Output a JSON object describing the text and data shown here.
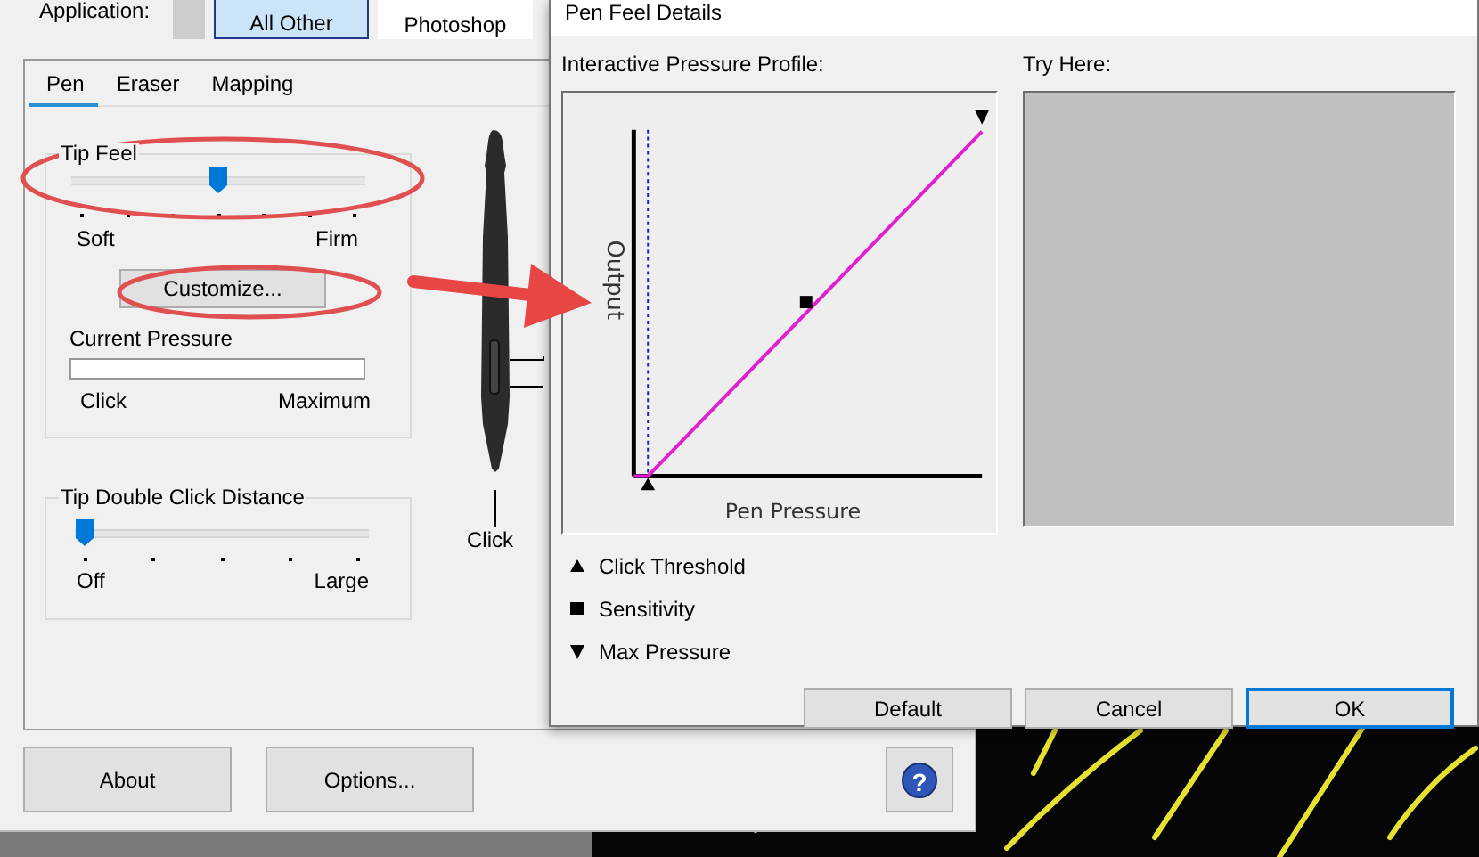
{
  "main_window": {
    "application_label": "Application:",
    "application_tiles": [
      {
        "label": "All Other",
        "selected": true
      },
      {
        "label": "Photoshop",
        "selected": false
      }
    ],
    "tabs": [
      {
        "label": "Pen",
        "selected": true
      },
      {
        "label": "Eraser",
        "selected": false
      },
      {
        "label": "Mapping",
        "selected": false
      }
    ],
    "tip_feel": {
      "title": "Tip Feel",
      "slider": {
        "level": 0.5
      },
      "min_label": "Soft",
      "max_label": "Firm",
      "button": "Customize...",
      "current_pressure": {
        "label": "Current Pressure",
        "min_label": "Click",
        "max_label": "Maximum"
      }
    },
    "tip_double_click_distance": {
      "title": "Tip Double Click Distance",
      "slider": {
        "level": 0
      },
      "min_label": "Off",
      "max_label": "Large"
    },
    "pen_callout": "Click",
    "buttons": [
      "About",
      "Options..."
    ],
    "help_button": "?"
  },
  "dialog": {
    "title": "Pen Feel Details",
    "profile_label": "Interactive Pressure Profile:",
    "try_label": "Try Here:",
    "graph": {
      "ylabel": "Output",
      "xlabel": "Pen Pressure"
    },
    "legend": [
      {
        "kind": "up-triangle",
        "label": "Click Threshold"
      },
      {
        "kind": "square",
        "label": "Sensitivity"
      },
      {
        "kind": "down-triangle",
        "label": "Max Pressure"
      }
    ],
    "buttons": [
      {
        "label": "Default",
        "default": false
      },
      {
        "label": "Cancel",
        "default": false
      },
      {
        "label": "OK",
        "default": true
      }
    ]
  }
}
